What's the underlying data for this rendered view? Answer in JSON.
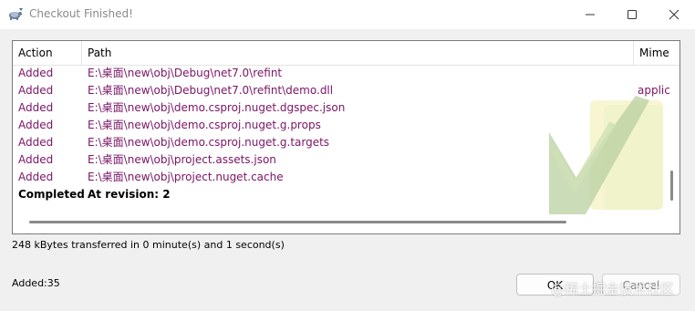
{
  "window": {
    "title": "Checkout Finished!",
    "icon": "tortoise-app-icon",
    "controls": [
      "minimize-icon",
      "maximize-icon",
      "close-icon"
    ]
  },
  "list": {
    "columns": [
      "Action",
      "Path",
      "Mime"
    ],
    "rows": [
      {
        "action": "Added",
        "path": "E:\\桌面\\new\\obj\\Debug\\net7.0\\refint",
        "mime": ""
      },
      {
        "action": "Added",
        "path": "E:\\桌面\\new\\obj\\Debug\\net7.0\\refint\\demo.dll",
        "mime": "applic"
      },
      {
        "action": "Added",
        "path": "E:\\桌面\\new\\obj\\demo.csproj.nuget.dgspec.json",
        "mime": ""
      },
      {
        "action": "Added",
        "path": "E:\\桌面\\new\\obj\\demo.csproj.nuget.g.props",
        "mime": ""
      },
      {
        "action": "Added",
        "path": "E:\\桌面\\new\\obj\\demo.csproj.nuget.g.targets",
        "mime": ""
      },
      {
        "action": "Added",
        "path": "E:\\桌面\\new\\obj\\project.assets.json",
        "mime": ""
      },
      {
        "action": "Added",
        "path": "E:\\桌面\\new\\obj\\project.nuget.cache",
        "mime": ""
      },
      {
        "action": "Completed",
        "path": "At revision: 2",
        "mime": ""
      }
    ],
    "colors": {
      "added": "#7a1466",
      "completed": "#000000"
    }
  },
  "status": {
    "transfer": "248 kBytes transferred in 0 minute(s) and 1 second(s)",
    "added": "Added:35"
  },
  "buttons": {
    "ok": "OK",
    "cancel": "Cancel"
  },
  "overlay": {
    "watermark": "@稀土掘金技术社区"
  }
}
